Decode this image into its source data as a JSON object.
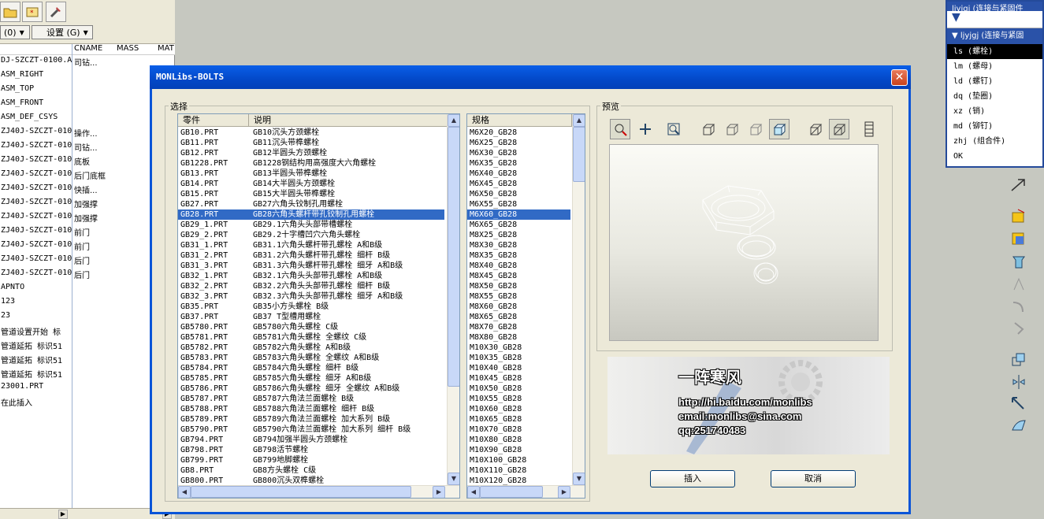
{
  "left_panel": {
    "dropdown1": "(0)",
    "dropdown2": "设置 (G)",
    "headers": {
      "cname": "CNAME",
      "mass": "MASS",
      "mat": "MAT"
    },
    "rows": [
      {
        "c1": "DJ-SZCZT-0100.A",
        "c2": "司钻..."
      },
      {
        "c1": "ASM_RIGHT",
        "c2": ""
      },
      {
        "c1": "ASM_TOP",
        "c2": ""
      },
      {
        "c1": "ASM_FRONT",
        "c2": ""
      },
      {
        "c1": "ASM_DEF_CSYS",
        "c2": ""
      },
      {
        "c1": "ZJ40J-SZCZT-010",
        "c2": "操作..."
      },
      {
        "c1": "ZJ40J-SZCZT-010",
        "c2": "司钻..."
      },
      {
        "c1": "ZJ40J-SZCZT-010",
        "c2": "底板"
      },
      {
        "c1": "ZJ40J-SZCZT-010",
        "c2": "后门底框"
      },
      {
        "c1": "ZJ40J-SZCZT-010",
        "c2": "快插..."
      },
      {
        "c1": "ZJ40J-SZCZT-010",
        "c2": "加强撑"
      },
      {
        "c1": "ZJ40J-SZCZT-010",
        "c2": "加强撑"
      },
      {
        "c1": "ZJ40J-SZCZT-010",
        "c2": "前门"
      },
      {
        "c1": "ZJ40J-SZCZT-010",
        "c2": "前门"
      },
      {
        "c1": "ZJ40J-SZCZT-010",
        "c2": "后门"
      },
      {
        "c1": "ZJ40J-SZCZT-010",
        "c2": "后门"
      },
      {
        "c1": "APNTO",
        "c2": ""
      },
      {
        "c1": "123",
        "c2": ""
      },
      {
        "c1": "23",
        "c2": ""
      },
      {
        "c1": "管道设置开始 标",
        "c2": ""
      },
      {
        "c1": "管道延拓 标识51",
        "c2": ""
      },
      {
        "c1": "管道延拓 标识51",
        "c2": ""
      },
      {
        "c1": "管道延拓 标识51",
        "c2": ""
      },
      {
        "c1": "23001.PRT",
        "c2": ""
      },
      {
        "c1": "在此插入",
        "c2": ""
      }
    ]
  },
  "menu_popup": {
    "title1": "ljyjgj (连接与紧固件",
    "title2": "ljyjgj (连接与紧固",
    "items": [
      {
        "label": "ls (螺栓)",
        "selected": true
      },
      {
        "label": "lm (螺母)",
        "selected": false
      },
      {
        "label": "ld (螺钉)",
        "selected": false
      },
      {
        "label": "dq (垫圈)",
        "selected": false
      },
      {
        "label": "xz (销)",
        "selected": false
      },
      {
        "label": "md (铆钉)",
        "selected": false
      },
      {
        "label": "zhj (组合件)",
        "selected": false
      },
      {
        "label": "OK",
        "selected": false
      }
    ]
  },
  "dialog": {
    "title": "MONLibs-BOLTS",
    "close_symbol": "✕",
    "select_group": "选择",
    "preview_group": "预览",
    "parts_headers": {
      "part": "零件",
      "desc": "说明"
    },
    "spec_header": "规格",
    "parts": [
      {
        "part": "GB10.PRT",
        "desc": "GB10沉头方颈螺栓",
        "selected": false
      },
      {
        "part": "GB11.PRT",
        "desc": "GB11沉头带榫螺栓",
        "selected": false
      },
      {
        "part": "GB12.PRT",
        "desc": "GB12半圆头方颈螺栓",
        "selected": false
      },
      {
        "part": "GB1228.PRT",
        "desc": "GB1228钢结构用高强度大六角螺栓",
        "selected": false
      },
      {
        "part": "GB13.PRT",
        "desc": "GB13半圆头带榫螺栓",
        "selected": false
      },
      {
        "part": "GB14.PRT",
        "desc": "GB14大半圆头方颈螺栓",
        "selected": false
      },
      {
        "part": "GB15.PRT",
        "desc": "GB15大半圆头带榫螺栓",
        "selected": false
      },
      {
        "part": "GB27.PRT",
        "desc": "GB27六角头铰制孔用螺栓",
        "selected": false
      },
      {
        "part": "GB28.PRT",
        "desc": "GB28六角头螺杆带孔铰制孔用螺栓",
        "selected": true
      },
      {
        "part": "GB29_1.PRT",
        "desc": "GB29.1六角头头部带槽螺栓",
        "selected": false
      },
      {
        "part": "GB29_2.PRT",
        "desc": "GB29.2十字槽凹穴六角头螺栓",
        "selected": false
      },
      {
        "part": "GB31_1.PRT",
        "desc": "GB31.1六角头螺杆带孔螺栓  A和B级",
        "selected": false
      },
      {
        "part": "GB31_2.PRT",
        "desc": "GB31.2六角头螺杆带孔螺栓  细杆  B级",
        "selected": false
      },
      {
        "part": "GB31_3.PRT",
        "desc": "GB31.3六角头螺杆带孔螺栓  细牙  A和B级",
        "selected": false
      },
      {
        "part": "GB32_1.PRT",
        "desc": "GB32.1六角头头部带孔螺栓  A和B级",
        "selected": false
      },
      {
        "part": "GB32_2.PRT",
        "desc": "GB32.2六角头头部带孔螺栓  细杆  B级",
        "selected": false
      },
      {
        "part": "GB32_3.PRT",
        "desc": "GB32.3六角头头部带孔螺栓  细牙  A和B级",
        "selected": false
      },
      {
        "part": "GB35.PRT",
        "desc": "GB35小方头螺栓  B级",
        "selected": false
      },
      {
        "part": "GB37.PRT",
        "desc": "GB37 T型槽用螺栓",
        "selected": false
      },
      {
        "part": "GB5780.PRT",
        "desc": "GB5780六角头螺栓  C级",
        "selected": false
      },
      {
        "part": "GB5781.PRT",
        "desc": "GB5781六角头螺栓  全螺纹  C级",
        "selected": false
      },
      {
        "part": "GB5782.PRT",
        "desc": "GB5782六角头螺栓  A和B级",
        "selected": false
      },
      {
        "part": "GB5783.PRT",
        "desc": "GB5783六角头螺栓  全螺纹  A和B级",
        "selected": false
      },
      {
        "part": "GB5784.PRT",
        "desc": "GB5784六角头螺栓  细杆  B级",
        "selected": false
      },
      {
        "part": "GB5785.PRT",
        "desc": "GB5785六角头螺栓  细牙  A和B级",
        "selected": false
      },
      {
        "part": "GB5786.PRT",
        "desc": "GB5786六角头螺栓  细牙  全螺纹  A和B级",
        "selected": false
      },
      {
        "part": "GB5787.PRT",
        "desc": "GB5787六角法兰面螺栓  B级",
        "selected": false
      },
      {
        "part": "GB5788.PRT",
        "desc": "GB5788六角法兰面螺栓  细杆  B级",
        "selected": false
      },
      {
        "part": "GB5789.PRT",
        "desc": "GB5789六角法兰面螺栓  加大系列  B级",
        "selected": false
      },
      {
        "part": "GB5790.PRT",
        "desc": "GB5790六角法兰面螺栓  加大系列  细杆  B级",
        "selected": false
      },
      {
        "part": "GB794.PRT",
        "desc": "GB794加强半圆头方颈螺栓",
        "selected": false
      },
      {
        "part": "GB798.PRT",
        "desc": "GB798活节螺栓",
        "selected": false
      },
      {
        "part": "GB799.PRT",
        "desc": "GB799地脚螺栓",
        "selected": false
      },
      {
        "part": "GB8.PRT",
        "desc": "GB8方头螺栓  C级",
        "selected": false
      },
      {
        "part": "GB800.PRT",
        "desc": "GB800沉头双榫螺栓",
        "selected": false
      }
    ],
    "specs": [
      {
        "v": "M6X20_GB28",
        "selected": false
      },
      {
        "v": "M6X25_GB28",
        "selected": false
      },
      {
        "v": "M6X30_GB28",
        "selected": false
      },
      {
        "v": "M6X35_GB28",
        "selected": false
      },
      {
        "v": "M6X40_GB28",
        "selected": false
      },
      {
        "v": "M6X45_GB28",
        "selected": false
      },
      {
        "v": "M6X50_GB28",
        "selected": false
      },
      {
        "v": "M6X55_GB28",
        "selected": false
      },
      {
        "v": "M6X60_GB28",
        "selected": true
      },
      {
        "v": "M6X65_GB28",
        "selected": false
      },
      {
        "v": "M8X25_GB28",
        "selected": false
      },
      {
        "v": "M8X30_GB28",
        "selected": false
      },
      {
        "v": "M8X35_GB28",
        "selected": false
      },
      {
        "v": "M8X40_GB28",
        "selected": false
      },
      {
        "v": "M8X45_GB28",
        "selected": false
      },
      {
        "v": "M8X50_GB28",
        "selected": false
      },
      {
        "v": "M8X55_GB28",
        "selected": false
      },
      {
        "v": "M8X60_GB28",
        "selected": false
      },
      {
        "v": "M8X65_GB28",
        "selected": false
      },
      {
        "v": "M8X70_GB28",
        "selected": false
      },
      {
        "v": "M8X80_GB28",
        "selected": false
      },
      {
        "v": "M10X30_GB28",
        "selected": false
      },
      {
        "v": "M10X35_GB28",
        "selected": false
      },
      {
        "v": "M10X40_GB28",
        "selected": false
      },
      {
        "v": "M10X45_GB28",
        "selected": false
      },
      {
        "v": "M10X50_GB28",
        "selected": false
      },
      {
        "v": "M10X55_GB28",
        "selected": false
      },
      {
        "v": "M10X60_GB28",
        "selected": false
      },
      {
        "v": "M10X65_GB28",
        "selected": false
      },
      {
        "v": "M10X70_GB28",
        "selected": false
      },
      {
        "v": "M10X80_GB28",
        "selected": false
      },
      {
        "v": "M10X90_GB28",
        "selected": false
      },
      {
        "v": "M10X100_GB28",
        "selected": false
      },
      {
        "v": "M10X110_GB28",
        "selected": false
      },
      {
        "v": "M10X120_GB28",
        "selected": false
      }
    ],
    "banner": {
      "name": "一阵寒风",
      "url": "http://hi.baidu.com/monlibs",
      "email": "email:monlibs@sina.com",
      "qq": "qq:251740483"
    },
    "insert_label": "插入",
    "cancel_label": "取消"
  },
  "colors": {
    "selection": "#316ac5",
    "titlebar": "#0348c8",
    "menu_header": "#2a52a8"
  }
}
